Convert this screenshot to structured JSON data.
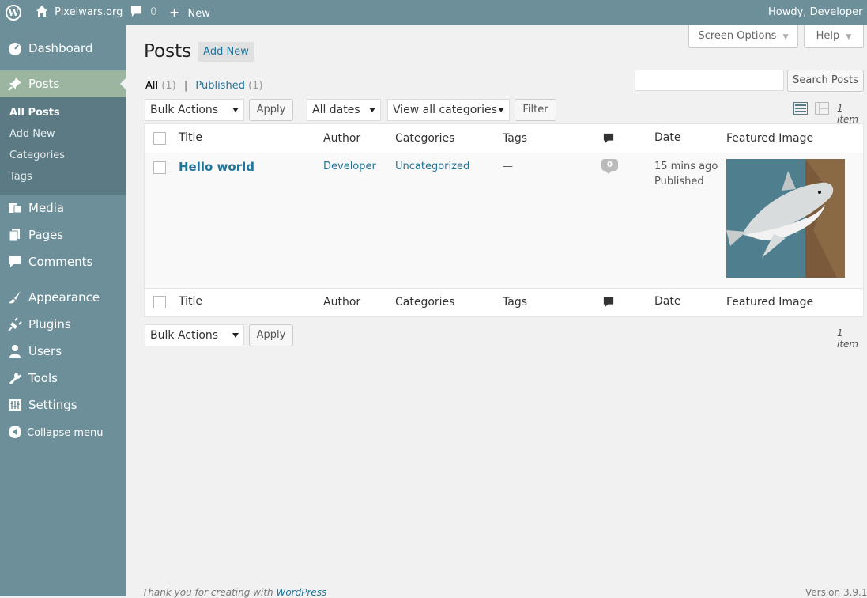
{
  "adminbar": {
    "site_name": "Pixelwars.org",
    "comments_count": "0",
    "new_label": "New",
    "howdy": "Howdy, Developer"
  },
  "sidebar": {
    "items": [
      {
        "label": "Dashboard",
        "icon": "dashboard-icon"
      },
      {
        "label": "Posts",
        "icon": "pin-icon"
      },
      {
        "label": "Media",
        "icon": "media-icon"
      },
      {
        "label": "Pages",
        "icon": "pages-icon"
      },
      {
        "label": "Comments",
        "icon": "comment-icon"
      },
      {
        "label": "Appearance",
        "icon": "brush-icon"
      },
      {
        "label": "Plugins",
        "icon": "plug-icon"
      },
      {
        "label": "Users",
        "icon": "user-icon"
      },
      {
        "label": "Tools",
        "icon": "wrench-icon"
      },
      {
        "label": "Settings",
        "icon": "settings-icon"
      }
    ],
    "submenu": [
      "All Posts",
      "Add New",
      "Categories",
      "Tags"
    ],
    "collapse_label": "Collapse menu"
  },
  "header": {
    "screen_options": "Screen Options",
    "help": "Help",
    "title": "Posts",
    "add_new": "Add New"
  },
  "filters": {
    "all_label": "All",
    "all_count": "(1)",
    "separator": "|",
    "published_label": "Published",
    "published_count": "(1)",
    "search_button": "Search Posts",
    "search_value": "",
    "bulk_actions": "Bulk Actions",
    "apply": "Apply",
    "all_dates": "All dates",
    "categories": "View all categories",
    "filter": "Filter",
    "item_count": "1 item"
  },
  "table": {
    "columns": [
      "Title",
      "Author",
      "Categories",
      "Tags",
      "Date",
      "Featured Image"
    ],
    "rows": [
      {
        "title": "Hello world",
        "author": "Developer",
        "categories": "Uncategorized",
        "tags": "—",
        "comments": "0",
        "date_line1": "15 mins ago",
        "date_line2": "Published"
      }
    ]
  },
  "footer": {
    "thank_you_prefix": "Thank you for creating with ",
    "wordpress_link": "WordPress",
    "version": "Version 3.9.1"
  }
}
